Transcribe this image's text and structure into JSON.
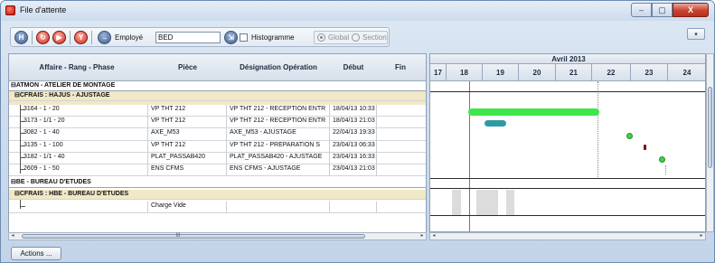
{
  "window": {
    "title": "File d'attente",
    "min": "–",
    "max": "▢",
    "close": "X",
    "corner": "▾"
  },
  "toolbar": {
    "employe_label": "Employé",
    "employe_value": "BED",
    "histogramme_label": "Histogramme",
    "global_label": "Global",
    "section_label": "Section"
  },
  "grid": {
    "headers": [
      "Affaire - Rang - Phase",
      "Pièce",
      "Désignation Opération",
      "Début",
      "Fin"
    ],
    "groups": [
      {
        "atelier": "ATMON - ATELIER DE MONTAGE",
        "section": "CFRAIS : HAJUS - AJUSTAGE",
        "rows": [
          [
            "3164 - 1 - 20",
            "VP THT 212",
            "VP THT 212 - RECEPTION ENTR",
            "18/04/13 10:33",
            ""
          ],
          [
            "3173 - 1/1 - 20",
            "VP THT 212",
            "VP THT 212 - RECEPTION ENTR",
            "18/04/13 21:03",
            ""
          ],
          [
            "3082 - 1 - 40",
            "AXE_M53",
            "AXE_M53 - AJUSTAGE",
            "22/04/13 19:33",
            ""
          ],
          [
            "3135 - 1 - 100",
            "VP THT 212",
            "VP THT 212 - PREPARATION S",
            "23/04/13 06:33",
            ""
          ],
          [
            "3182 - 1/1 - 40",
            "PLAT_PASSAB420",
            "PLAT_PASSAB420 - AJUSTAGE",
            "23/04/13 16:33",
            ""
          ],
          [
            "2609 - 1 - 50",
            "ENS CFMS",
            "ENS CFMS - AJUSTAGE",
            "23/04/13 21:03",
            ""
          ]
        ]
      },
      {
        "atelier": "BE - BUREAU D'ETUDES",
        "section": "CFRAIS : HBE - BUREAU D'ETUDES",
        "rows": [
          [
            "",
            "Charge Vide",
            "",
            "",
            ""
          ]
        ]
      }
    ]
  },
  "gantt": {
    "month": "Avril 2013",
    "days": [
      "17",
      "18",
      "19",
      "20",
      "21",
      "22",
      "23",
      "24"
    ],
    "colors": {
      "bar_green": "#3ee64c",
      "bar_teal": "#2e9aa3",
      "today": "#e0541a",
      "marker_dark": "#6b1a10"
    }
  },
  "scroll": {
    "left_grip": "III",
    "left": "◂",
    "right": "▸"
  },
  "actions_label": "Actions ..."
}
